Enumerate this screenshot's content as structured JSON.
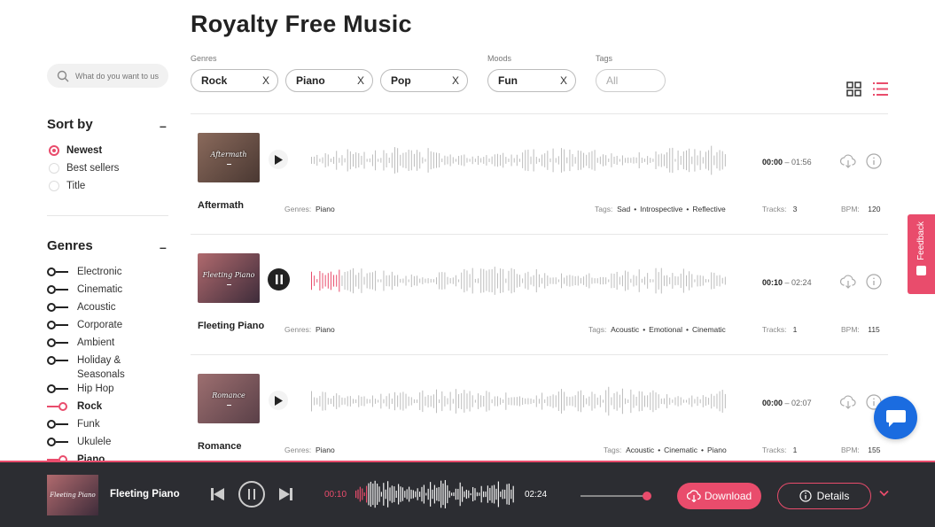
{
  "page_title": "Royalty Free Music",
  "search": {
    "placeholder": "What do you want to us"
  },
  "filters": {
    "genres_label": "Genres",
    "moods_label": "Moods",
    "tags_label": "Tags",
    "genre_chips": [
      "Rock",
      "Piano",
      "Pop"
    ],
    "mood_chips": [
      "Fun"
    ],
    "tags_placeholder": "All",
    "remove_label": "X"
  },
  "sort": {
    "heading": "Sort by",
    "collapse": "–",
    "options": [
      "Newest",
      "Best sellers",
      "Title"
    ],
    "selected": "Newest"
  },
  "genres": {
    "heading": "Genres",
    "collapse": "–",
    "items": [
      {
        "label": "Electronic",
        "on": false
      },
      {
        "label": "Cinematic",
        "on": false
      },
      {
        "label": "Acoustic",
        "on": false
      },
      {
        "label": "Corporate",
        "on": false
      },
      {
        "label": "Ambient",
        "on": false
      },
      {
        "label": "Holiday &",
        "label2": "Seasonals",
        "on": false
      },
      {
        "label": "Hip Hop",
        "on": false
      },
      {
        "label": "Rock",
        "on": true
      },
      {
        "label": "Funk",
        "on": false
      },
      {
        "label": "Ukulele",
        "on": false
      },
      {
        "label": "Piano",
        "on": true
      }
    ]
  },
  "meta_labels": {
    "genres": "Genres:",
    "tags": "Tags:",
    "tracks": "Tracks:",
    "bpm": "BPM:"
  },
  "tracks": [
    {
      "name": "Aftermath",
      "thumb_text": "Aftermath",
      "current": "00:00",
      "duration": "01:56",
      "genre": "Piano",
      "tags": [
        "Sad",
        "Introspective",
        "Reflective"
      ],
      "tracks": "3",
      "bpm": "120",
      "playing": false,
      "progress": 0
    },
    {
      "name": "Fleeting Piano",
      "thumb_text": "Fleeting Piano",
      "current": "00:10",
      "duration": "02:24",
      "genre": "Piano",
      "tags": [
        "Acoustic",
        "Emotional",
        "Cinematic"
      ],
      "tracks": "1",
      "bpm": "115",
      "playing": true,
      "progress": 0.07
    },
    {
      "name": "Romance",
      "thumb_text": "Romance",
      "current": "00:00",
      "duration": "02:07",
      "genre": "Piano",
      "tags": [
        "Acoustic",
        "Cinematic",
        "Piano"
      ],
      "tracks": "1",
      "bpm": "155",
      "playing": false,
      "progress": 0
    }
  ],
  "feedback_label": "Feedback",
  "player": {
    "title": "Fleeting Piano",
    "thumb_text": "Fleeting Piano",
    "current": "00:10",
    "duration": "02:24",
    "volume": 1.0,
    "download_label": "Download",
    "details_label": "Details"
  },
  "colors": {
    "accent": "#e94c6c",
    "player_bg": "#2c2d32",
    "chat": "#1b6ce0"
  }
}
